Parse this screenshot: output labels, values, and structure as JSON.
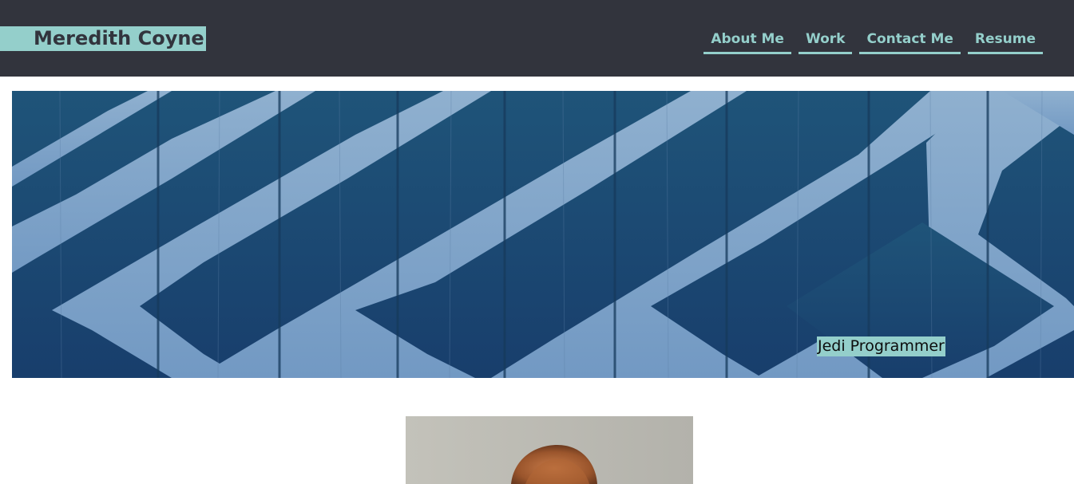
{
  "header": {
    "brand_name": "Meredith Coyne",
    "nav": [
      {
        "label": "About Me"
      },
      {
        "label": "Work"
      },
      {
        "label": "Contact Me"
      },
      {
        "label": "Resume"
      }
    ]
  },
  "hero": {
    "tagline": "Jedi Programmer"
  },
  "colors": {
    "header_bg": "#32343d",
    "accent": "#94cfcb",
    "hero_dark": "#1d4b72",
    "hero_light": "#7fa4c8"
  }
}
